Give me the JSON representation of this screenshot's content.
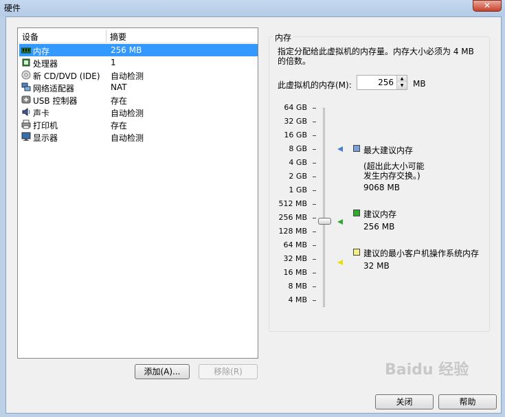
{
  "window": {
    "title": "硬件",
    "close_symbol": "✕"
  },
  "device_list": {
    "col_device": "设备",
    "col_summary": "摘要",
    "rows": [
      {
        "device": "内存",
        "summary": "256 MB",
        "icon": "memory-icon",
        "selected": true
      },
      {
        "device": "处理器",
        "summary": "1",
        "icon": "processor-icon"
      },
      {
        "device": "新 CD/DVD (IDE)",
        "summary": "自动检测",
        "icon": "cd-dvd-icon"
      },
      {
        "device": "网络适配器",
        "summary": "NAT",
        "icon": "network-icon"
      },
      {
        "device": "USB 控制器",
        "summary": "存在",
        "icon": "usb-icon"
      },
      {
        "device": "声卡",
        "summary": "自动检测",
        "icon": "sound-icon"
      },
      {
        "device": "打印机",
        "summary": "存在",
        "icon": "printer-icon"
      },
      {
        "device": "显示器",
        "summary": "自动检测",
        "icon": "monitor-icon"
      }
    ]
  },
  "buttons": {
    "add": "添加(A)...",
    "remove": "移除(R)",
    "close": "关闭",
    "help": "帮助"
  },
  "memory": {
    "group_title": "内存",
    "description": "指定分配给此虚拟机的内存量。内存大小必须为 4 MB 的倍数。",
    "field_label": "此虚拟机的内存(M):",
    "value": "256",
    "unit": "MB",
    "scale": [
      "64 GB",
      "32 GB",
      "16 GB",
      "8 GB",
      "4 GB",
      "2 GB",
      "1 GB",
      "512 MB",
      "256 MB",
      "128 MB",
      "64 MB",
      "32 MB",
      "16 MB",
      "8 MB",
      "4 MB"
    ],
    "slider_value": "256 MB",
    "legend": {
      "max_title": "最大建议内存",
      "max_note_1": "(超出此大小可能",
      "max_note_2": "发生内存交换。)",
      "max_value": "9068 MB",
      "rec_title": "建议内存",
      "rec_value": "256 MB",
      "min_title": "建议的最小客户机操作系统内存",
      "min_value": "32 MB"
    },
    "colors": {
      "max": "#4a7fd0",
      "rec": "#2eaa2e",
      "min": "#e8e000"
    }
  },
  "watermark": "Baidu 经验"
}
